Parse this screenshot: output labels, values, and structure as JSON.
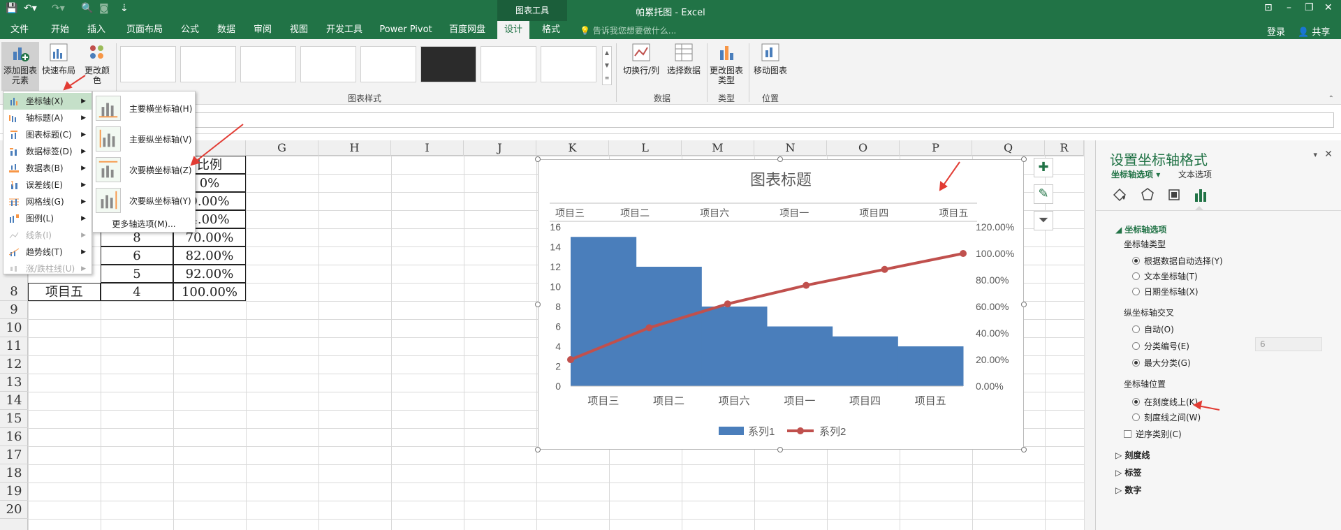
{
  "titlebar": {
    "context_group": "图表工具",
    "doc_title": "帕累托图 - Excel",
    "login": "登录",
    "share": "共享"
  },
  "tabs": [
    {
      "label": "文件"
    },
    {
      "label": "开始"
    },
    {
      "label": "插入"
    },
    {
      "label": "页面布局"
    },
    {
      "label": "公式"
    },
    {
      "label": "数据"
    },
    {
      "label": "审阅"
    },
    {
      "label": "视图"
    },
    {
      "label": "开发工具"
    },
    {
      "label": "Power Pivot"
    },
    {
      "label": "百度网盘"
    },
    {
      "label": "设计"
    },
    {
      "label": "格式"
    }
  ],
  "tell_me": "告诉我您想要做什么...",
  "ribbon": {
    "add_element": "添加图表元素",
    "quick_layout": "快速布局",
    "change_color": "更改颜色",
    "styles_group": "图表样式",
    "switch_rowcol": "切换行/列",
    "select_data": "选择数据",
    "data_group": "数据",
    "change_type": "更改图表类型",
    "type_group": "类型",
    "move_chart": "移动图表",
    "location_group": "位置"
  },
  "menu": {
    "items": [
      {
        "label": "坐标轴(X)",
        "disabled": false
      },
      {
        "label": "轴标题(A)",
        "disabled": false
      },
      {
        "label": "图表标题(C)",
        "disabled": false
      },
      {
        "label": "数据标签(D)",
        "disabled": false
      },
      {
        "label": "数据表(B)",
        "disabled": false
      },
      {
        "label": "误差线(E)",
        "disabled": false
      },
      {
        "label": "网格线(G)",
        "disabled": false
      },
      {
        "label": "图例(L)",
        "disabled": false
      },
      {
        "label": "线条(I)",
        "disabled": true
      },
      {
        "label": "趋势线(T)",
        "disabled": false
      },
      {
        "label": "涨/跌柱线(U)",
        "disabled": true
      }
    ],
    "submenu": [
      {
        "label": "主要横坐标轴(H)"
      },
      {
        "label": "主要纵坐标轴(V)"
      },
      {
        "label": "次要横坐标轴(Z)"
      },
      {
        "label": "次要纵坐标轴(Y)"
      }
    ],
    "more": "更多轴选项(M)..."
  },
  "columns": [
    "G",
    "H",
    "I",
    "J",
    "K",
    "L",
    "M",
    "N",
    "O",
    "P",
    "Q",
    "R"
  ],
  "rows": [
    "9",
    "10",
    "11",
    "12",
    "13",
    "14",
    "15",
    "16",
    "17",
    "18",
    "19",
    "20"
  ],
  "table": {
    "header_partial": "比例",
    "ratio_cells": [
      "0%",
      "0.00%",
      "4.00%",
      "70.00%",
      "82.00%",
      "92.00%",
      "100.00%"
    ],
    "count_cells": [
      "8",
      "6",
      "5",
      "4"
    ],
    "name_cells": [
      "项目五"
    ],
    "row_numbers": [
      "8"
    ]
  },
  "chart_data": {
    "type": "bar",
    "title": "图表标题",
    "categories": [
      "项目三",
      "项目二",
      "项目六",
      "项目一",
      "项目四",
      "项目五"
    ],
    "series": [
      {
        "name": "系列1",
        "type": "bar",
        "axis": "primary",
        "values": [
          15,
          12,
          8,
          6,
          5,
          4
        ],
        "color": "#4a7ebb"
      },
      {
        "name": "系列2",
        "type": "line",
        "axis": "secondary",
        "values": [
          0.2,
          0.44,
          0.62,
          0.76,
          0.88,
          1.0
        ],
        "color": "#c0504d"
      }
    ],
    "ylim": [
      0,
      16
    ],
    "yticks": [
      "0",
      "2",
      "4",
      "6",
      "8",
      "10",
      "12",
      "14",
      "16"
    ],
    "y2lim": [
      0,
      1.2
    ],
    "y2ticks": [
      "0.00%",
      "20.00%",
      "40.00%",
      "60.00%",
      "80.00%",
      "100.00%",
      "120.00%"
    ],
    "legend": "bottom",
    "secondary_x_axis": true
  },
  "panel": {
    "title": "设置坐标轴格式",
    "tab_axis": "坐标轴选项",
    "tab_text": "文本选项",
    "section": "坐标轴选项",
    "axis_type_label": "坐标轴类型",
    "axis_type_opts": [
      {
        "label": "根据数据自动选择(Y)",
        "on": true
      },
      {
        "label": "文本坐标轴(T)",
        "on": false
      },
      {
        "label": "日期坐标轴(X)",
        "on": false
      }
    ],
    "cross_label": "纵坐标轴交叉",
    "cross_opts": [
      {
        "label": "自动(O)",
        "on": false
      },
      {
        "label": "分类编号(E)",
        "on": false
      },
      {
        "label": "最大分类(G)",
        "on": true
      }
    ],
    "cross_value": "6",
    "pos_label": "坐标轴位置",
    "pos_opts": [
      {
        "label": "在刻度线上(K)",
        "on": true
      },
      {
        "label": "刻度线之间(W)",
        "on": false
      }
    ],
    "reverse": "逆序类别(C)",
    "collapsed": [
      "刻度线",
      "标签",
      "数字"
    ]
  }
}
